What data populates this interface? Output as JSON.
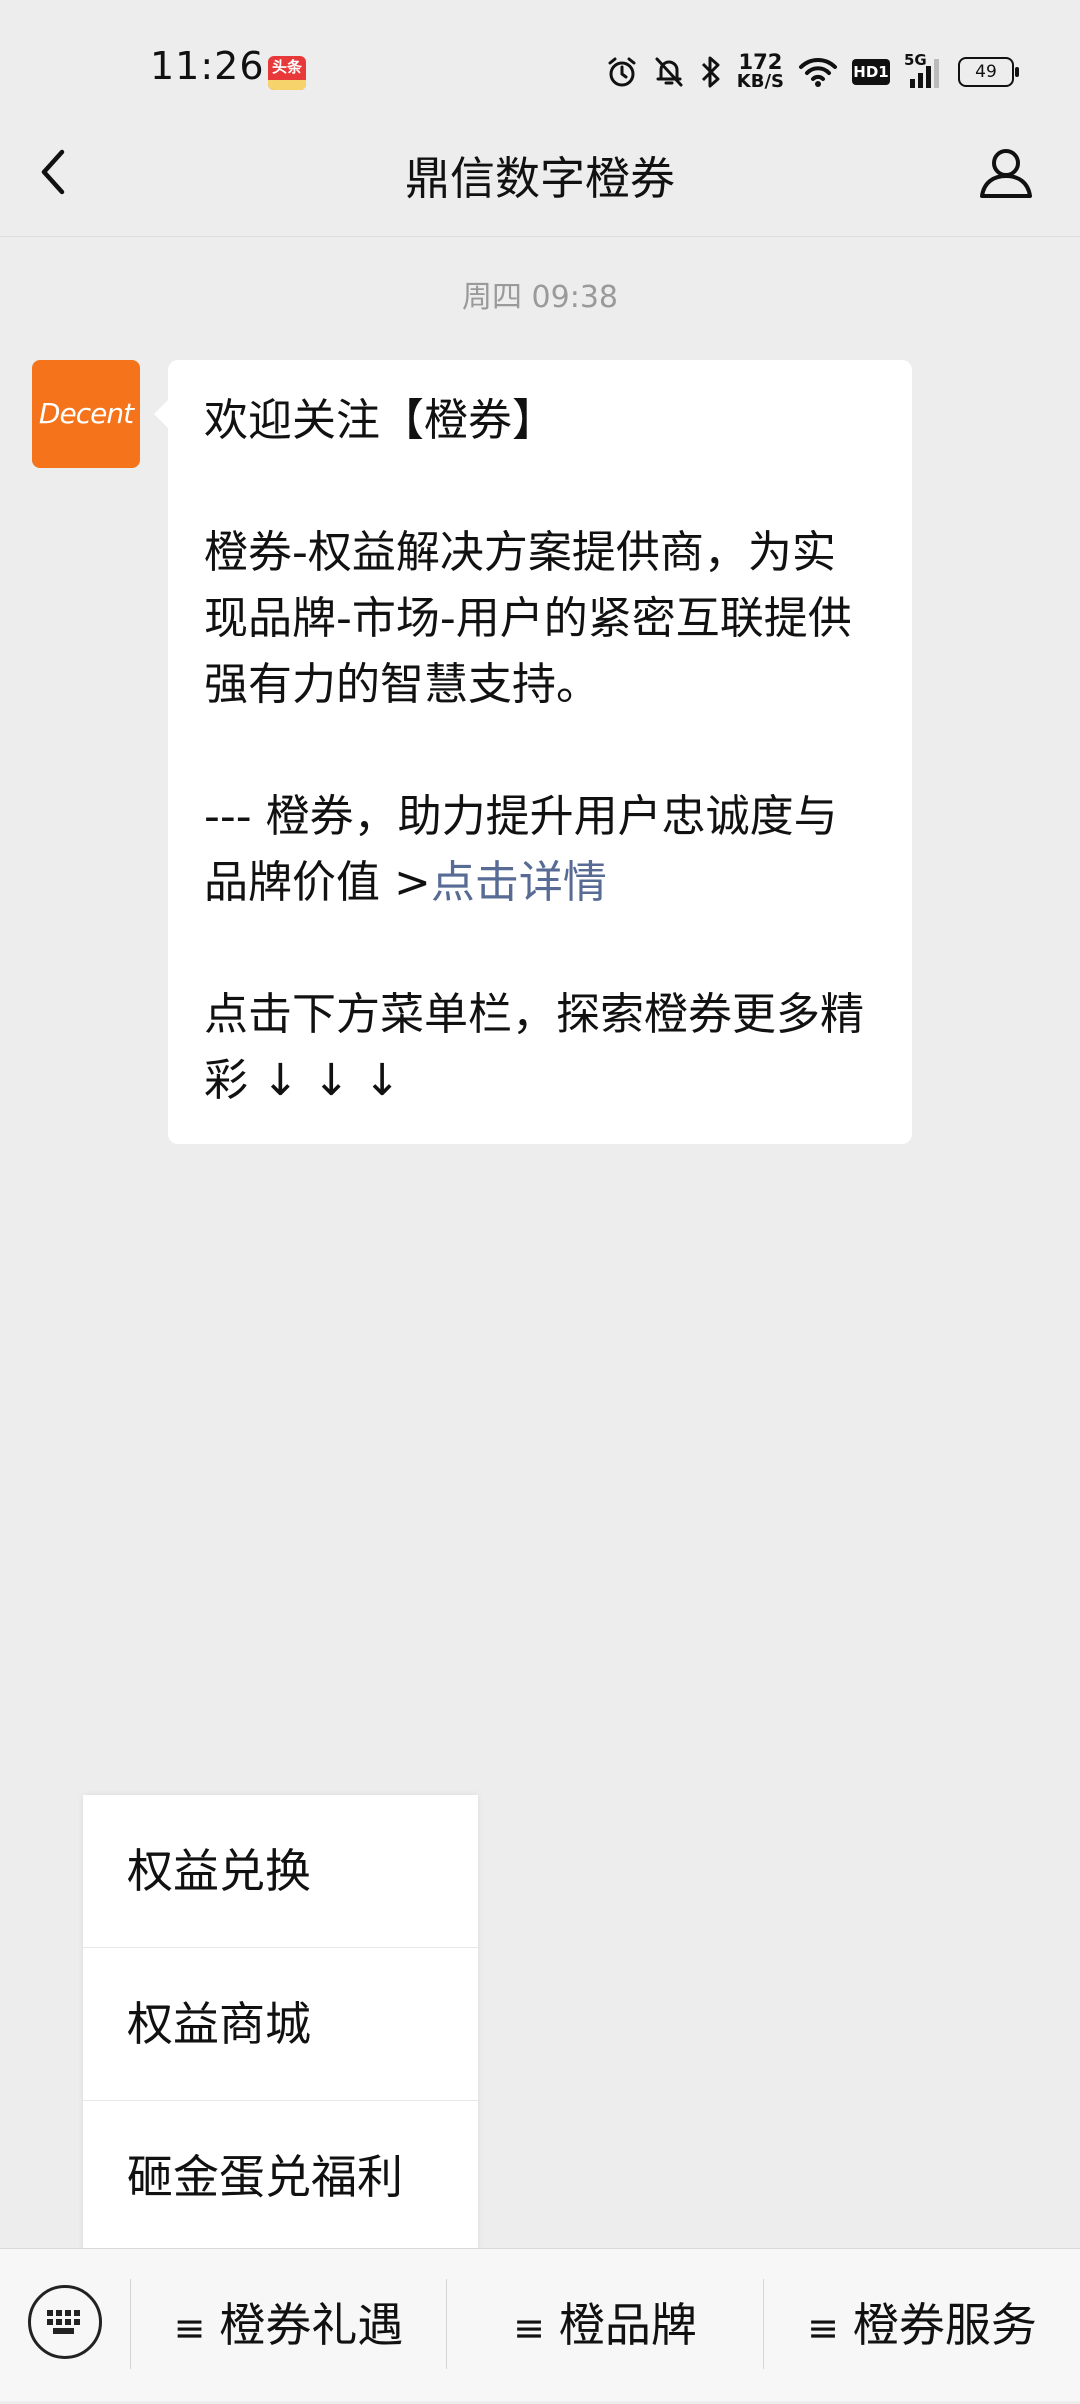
{
  "status_bar": {
    "time": "11:26",
    "app_badge": "头条",
    "net_speed_value": "172",
    "net_speed_unit": "KB/S",
    "hd_label": "HD1",
    "signal_label": "5G",
    "battery": "49"
  },
  "nav": {
    "title": "鼎信数字橙券",
    "back_icon": "chevron-left-icon",
    "profile_icon": "person-icon"
  },
  "chat": {
    "timestamp": "周四 09:38",
    "avatar_text": "Decent",
    "message": {
      "line1": "欢迎关注【橙券】",
      "para2": "橙券-权益解决方案提供商，为实现品牌-市场-用户的紧密互联提供强有力的智慧支持。",
      "para3_text": "--- 橙券，助力提升用户忠诚度与品牌价值 >",
      "para3_link": "点击详情",
      "para4": "点击下方菜单栏，探索橙券更多精彩 ↓ ↓ ↓"
    }
  },
  "popup_menu": {
    "items": [
      "权益兑换",
      "权益商城",
      "砸金蛋兑福利"
    ]
  },
  "bottom_menu": {
    "keyboard_icon": "keyboard-icon",
    "hamburger": "≡",
    "items": [
      "橙券礼遇",
      "橙品牌",
      "橙券服务"
    ]
  },
  "colors": {
    "background": "#ededed",
    "bubble": "#ffffff",
    "link": "#576b95",
    "avatar": "#f5731b"
  }
}
